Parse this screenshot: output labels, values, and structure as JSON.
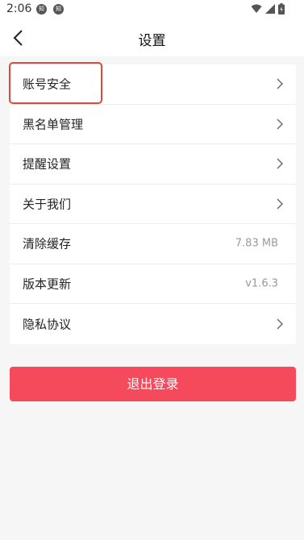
{
  "status_bar": {
    "time": "2:06",
    "notif_icons": [
      "notification-icon",
      "notification-icon"
    ]
  },
  "nav": {
    "title": "设置",
    "back_icon": "chevron-left-icon"
  },
  "settings_list": [
    {
      "label": "账号安全",
      "icon": "chevron-right-icon"
    },
    {
      "label": "黑名单管理",
      "icon": "chevron-right-icon"
    },
    {
      "label": "提醒设置",
      "icon": "chevron-right-icon"
    },
    {
      "label": "关于我们",
      "icon": "chevron-right-icon"
    },
    {
      "label": "清除缓存",
      "value": "7.83 MB"
    },
    {
      "label": "版本更新",
      "value": "v1.6.3"
    },
    {
      "label": "隐私协议",
      "icon": "chevron-right-icon"
    }
  ],
  "logout_button": {
    "label": "退出登录"
  },
  "colors": {
    "accent": "#f44a5c",
    "highlight": "#e0463a",
    "background": "#f6f6f6"
  }
}
